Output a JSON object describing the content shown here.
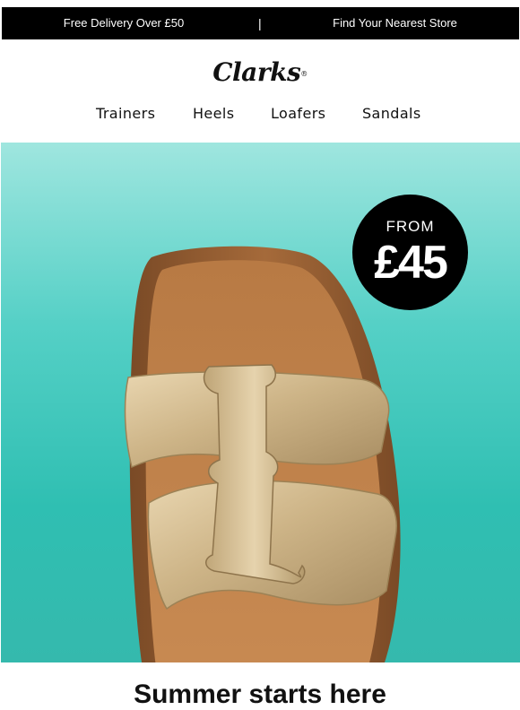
{
  "topbar": {
    "left": "Free Delivery Over £50",
    "separator": "|",
    "right": "Find Your Nearest Store"
  },
  "brand": {
    "name": "Clarks",
    "mark": "®"
  },
  "nav": {
    "items": [
      "Trainers",
      "Heels",
      "Loafers",
      "Sandals"
    ]
  },
  "badge": {
    "from": "FROM",
    "price": "£45"
  },
  "hero": {
    "image_icon": "gold-leather-sandal",
    "colors": {
      "bg_top": "#9fe6df",
      "bg_bottom": "#35b9ad"
    }
  },
  "headline": "Summer starts here"
}
